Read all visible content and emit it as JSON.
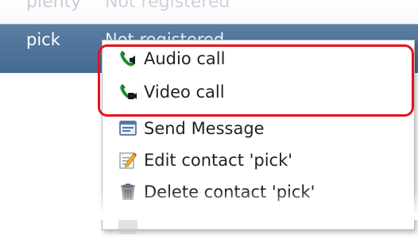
{
  "contact_list": {
    "ghost_row": {
      "name": "plenty",
      "status": "Not registered"
    },
    "selected_row": {
      "name": "pick",
      "status": "Not registered"
    }
  },
  "context_menu": {
    "items": [
      {
        "label": "Audio call",
        "icon": "audio-call-icon"
      },
      {
        "label": "Video call",
        "icon": "video-call-icon"
      },
      {
        "label": "Send Message",
        "icon": "message-icon"
      },
      {
        "label": "Edit contact 'pick'",
        "icon": "edit-icon"
      },
      {
        "label": "Delete contact 'pick'",
        "icon": "delete-icon"
      }
    ]
  },
  "colors": {
    "selection": "#4f7299",
    "highlight": "#e8111c",
    "call_green": "#1a8a2a"
  }
}
